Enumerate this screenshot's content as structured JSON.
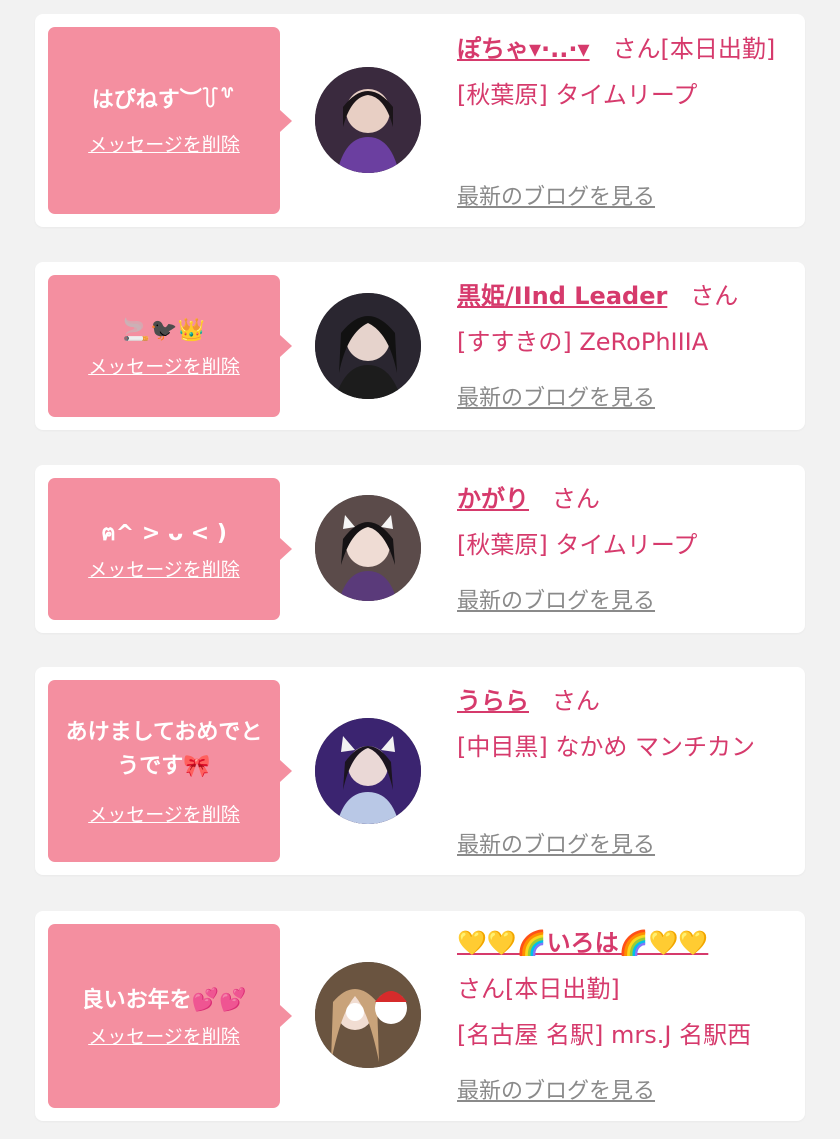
{
  "colors": {
    "accent": "#d63a6c",
    "bubble": "#f48fa0",
    "blog_link": "#8a8a8a"
  },
  "cards": [
    {
      "message": "はぴねす︶꒦꒷",
      "delete_label": "メッセージを削除",
      "name": "ぽちゃ▾·..·▾",
      "honorific": "さん[本日出勤]",
      "shop": "[秋葉原] タイムリープ",
      "blog_label": "最新のブログを見る"
    },
    {
      "message": "🚬🐦‍⬛👑",
      "delete_label": "メッセージを削除",
      "name": "黒姫/IInd Leader",
      "honorific": "さん",
      "shop": "[すすきの] ZeRoPhIIIA",
      "blog_label": "最新のブログを見る"
    },
    {
      "message": "ฅ^ > ᴗ < )",
      "delete_label": "メッセージを削除",
      "name": "かがり",
      "honorific": "さん",
      "shop": "[秋葉原] タイムリープ",
      "blog_label": "最新のブログを見る"
    },
    {
      "message": "あけましておめでとうです🎀",
      "delete_label": "メッセージを削除",
      "name": "うらら",
      "honorific": "さん",
      "shop": "[中目黒] なかめ マンチカン",
      "blog_label": "最新のブログを見る"
    },
    {
      "message": "良いお年を💕💕",
      "delete_label": "メッセージを削除",
      "name": "💛💛🌈いろは🌈💛💛",
      "honorific": "さん[本日出勤]",
      "shop": "[名古屋 名駅] mrs.J 名駅西",
      "blog_label": "最新のブログを見る"
    }
  ]
}
